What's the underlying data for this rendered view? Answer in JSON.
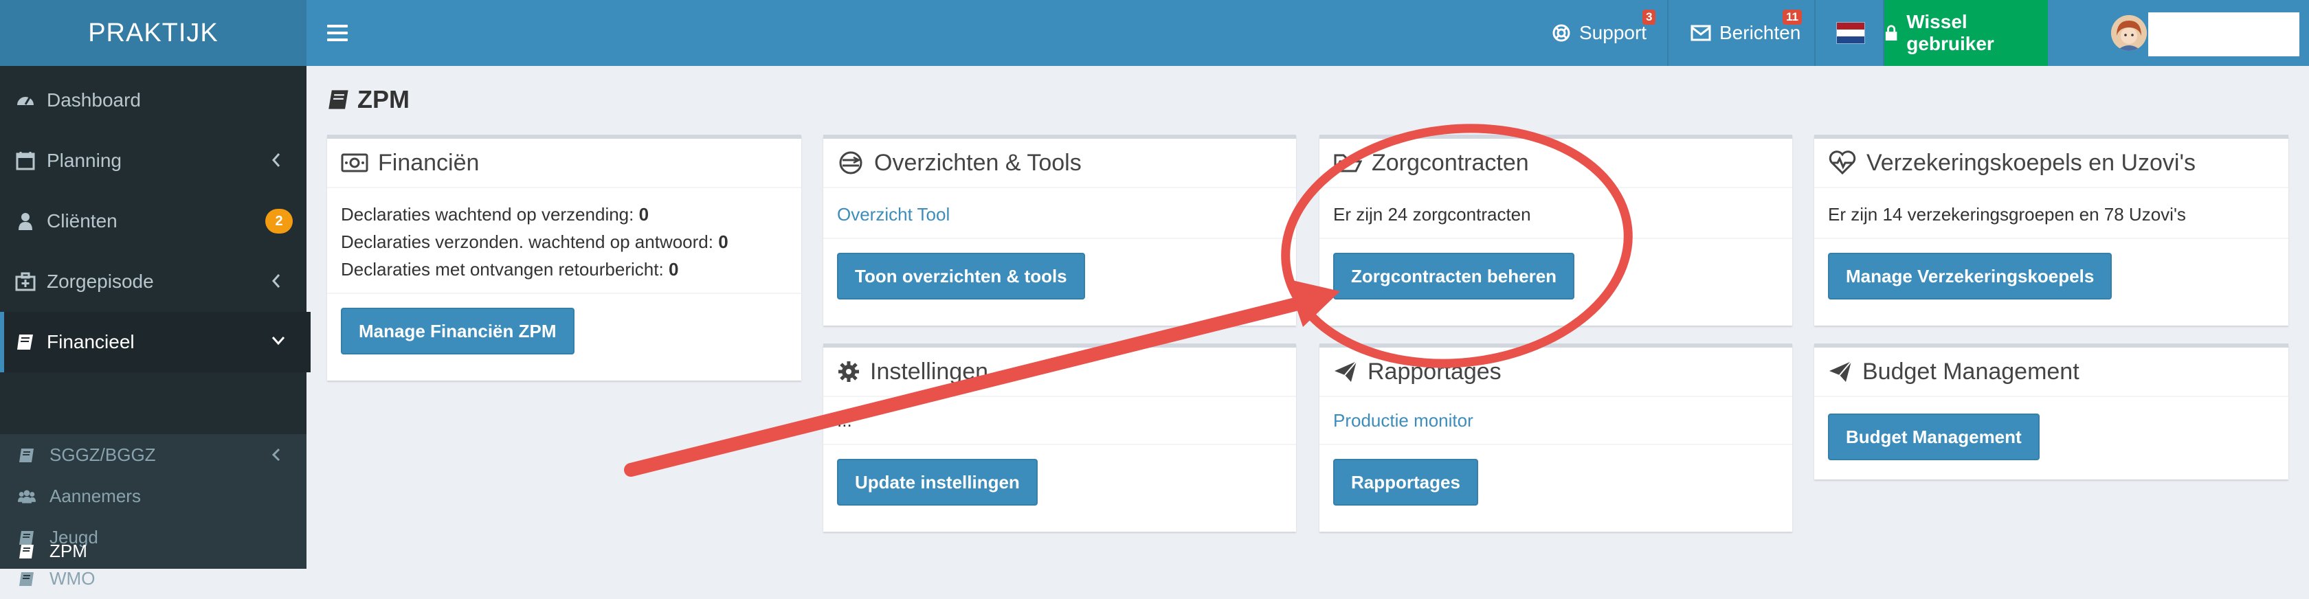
{
  "brand": "PRAKTIJK",
  "topbar": {
    "support_label": "Support",
    "support_badge": "3",
    "berichten_label": "Berichten",
    "berichten_badge": "11",
    "wissel_label": "Wissel gebruiker"
  },
  "sidebar": {
    "items": [
      {
        "label": "Dashboard",
        "icon": "dashboard-icon"
      },
      {
        "label": "Planning",
        "icon": "calendar-icon"
      },
      {
        "label": "Cliënten",
        "icon": "user-icon",
        "badge": "2"
      },
      {
        "label": "Zorgepisode",
        "icon": "medkit-icon"
      },
      {
        "label": "Financieel",
        "icon": "book-icon"
      }
    ],
    "subitems": [
      {
        "label": "SGGZ/BGGZ",
        "icon": "book-icon"
      },
      {
        "label": "Aannemers",
        "icon": "users-icon"
      },
      {
        "label": "Jeugd",
        "icon": "book-icon"
      },
      {
        "label": "WMO",
        "icon": "book-icon"
      },
      {
        "label": "ZPM",
        "icon": "book-icon"
      }
    ]
  },
  "page_title": "ZPM",
  "boxes": {
    "financien": {
      "title": "Financiën",
      "line1": "Declaraties wachtend op verzending:",
      "line1_value": "0",
      "line2": "Declaraties verzonden. wachtend op antwoord:",
      "line2_value": "0",
      "line3": "Declaraties met ontvangen retourbericht:",
      "line3_value": "0",
      "button": "Manage Financiën ZPM"
    },
    "overzichten": {
      "title": "Overzichten & Tools",
      "link": "Overzicht Tool",
      "button": "Toon overzichten & tools"
    },
    "zorgcontracten": {
      "title": "Zorgcontracten",
      "text": "Er zijn 24 zorgcontracten",
      "button": "Zorgcontracten beheren"
    },
    "verzekeringskoepels": {
      "title": "Verzekeringskoepels en Uzovi's",
      "text": "Er zijn 14 verzekeringsgroepen en 78 Uzovi's",
      "button": "Manage Verzekeringskoepels"
    },
    "instellingen": {
      "title": "Instellingen",
      "text": "...",
      "button": "Update instellingen"
    },
    "rapportages": {
      "title": "Rapportages",
      "link": "Productie monitor",
      "button": "Rapportages"
    },
    "budget": {
      "title": "Budget Management",
      "button": "Budget Management"
    }
  },
  "colors": {
    "header": "#3c8dbc",
    "brand": "#357ca5",
    "sidebar": "#222d32",
    "success": "#00a65a",
    "annotation": "#e8524a"
  }
}
